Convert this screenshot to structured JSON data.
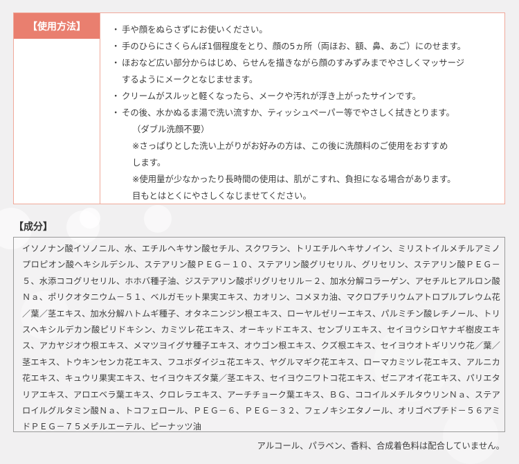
{
  "usage": {
    "heading": "【使用方法】",
    "items": [
      {
        "bullet": "・",
        "text": "手や顔をぬらさずにお使いください。"
      },
      {
        "bullet": "・",
        "text": "手のひらにさくらんぼ1個程度をとり、顔の5ヵ所（両ほお、額、鼻、あご）にのせます。"
      },
      {
        "bullet": "・",
        "text": "ほおなど広い部分からはじめ、らせんを描きながら顔のすみずみまでやさしくマッサージ"
      },
      {
        "bullet": "",
        "text": "するようにメークとなじませます。"
      },
      {
        "bullet": "・",
        "text": "クリームがスルッと軽くなったら、メークや汚れが浮き上がったサインです。"
      },
      {
        "bullet": "・",
        "text": "その後、水かぬるま湯で洗い流すか、ティッシュペーパー等でやさしく拭きとります。"
      },
      {
        "bullet": "",
        "text": "（ダブル洗顔不要）",
        "sub": true
      },
      {
        "bullet": "",
        "text": "※さっぱりとした洗い上がりがお好みの方は、この後に洗顔料のご使用をおすすめ",
        "sub": true
      },
      {
        "bullet": "",
        "text": "します。",
        "sub": true
      },
      {
        "bullet": "",
        "text": "※使用量が少なかったり長時間の使用は、肌がこすれ、負担になる場合があります。",
        "sub": true
      },
      {
        "bullet": "",
        "text": "目もとはとくにやさしくなじませてください。",
        "sub": true
      }
    ]
  },
  "ingredients": {
    "heading": "【成分】",
    "text": "イソノナン酸イソノニル、水、エチルヘキサン酸セチル、スクワラン、トリエチルヘキサノイン、ミリストイルメチルアミノプロピオン酸ヘキシルデシル、ステアリン酸ＰＥＧ－１０、ステアリン酸グリセリル、グリセリン、ステアリン酸ＰＥＧ－５、水添ココグリセリル、ホホバ種子油、ジステアリン酸ポリグリセリル－２、加水分解コラーゲン、アセチルヒアルロン酸Ｎａ、ポリクオタニウム－５１、ベルガモット果実エキス、カオリン、コメヌカ油、マクロプチリウムアトロプルプレウム花／葉／茎エキス、加水分解ハトムギ種子、オタネニンジン根エキス、ローヤルゼリーエキス、パルミチン酸レチノール、トリスヘキシルデカン酸ピリドキシン、カミツレ花エキス、オーキッドエキス、センブリエキス、セイヨウシロヤナギ樹皮エキス、アカヤジオウ根エキス、メマツヨイグサ種子エキス、オウゴン根エキス、クズ根エキス、セイヨウオトギリソウ花／葉／茎エキス、トウキンセンカ花エキス、フユボダイジュ花エキス、ヤグルマギク花エキス、ローマカミツレ花エキス、アルニカ花エキス、キュウリ果実エキス、セイヨウキズタ葉／茎エキス、セイヨウニワトコ花エキス、ゼニアオイ花エキス、パリエタリアエキス、アロエベラ葉エキス、クロレラエキス、アーチチョーク葉エキス、ＢＧ、ココイルメチルタウリンＮａ、ステアロイルグルタミン酸Ｎａ、トコフェロール、ＰＥＧ－６、ＰＥＧ－３２、フェノキシエタノール、オリゴペプチド－５６アミドＰＥＧ－７５メチルエーテル、ピーナッツ油"
  },
  "footer_note": "アルコール、パラベン、香料、合成着色料は配合していません。",
  "colors": {
    "accent": "#e97f6f",
    "border": "#f0a899",
    "background": "#f1f0f1"
  }
}
